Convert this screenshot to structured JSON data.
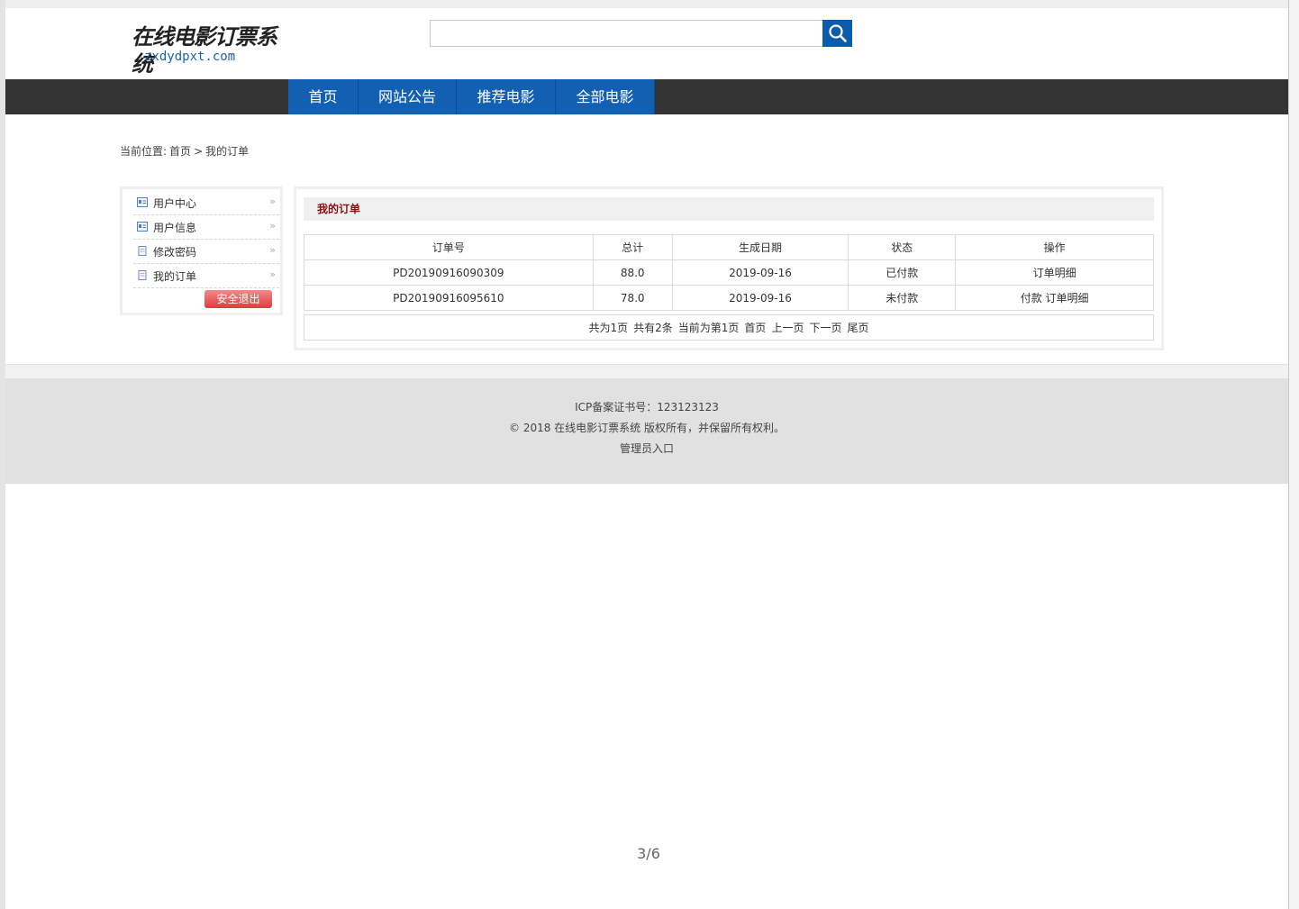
{
  "header": {
    "logo_title": "在线电影订票系统",
    "logo_domain": "zxdydpxt.com",
    "search": {
      "placeholder": "",
      "value": ""
    }
  },
  "nav": {
    "items": [
      {
        "label": "首页"
      },
      {
        "label": "网站公告"
      },
      {
        "label": "推荐电影"
      },
      {
        "label": "全部电影"
      }
    ],
    "colors": {
      "bar": "#333333",
      "item": "#1360b3"
    }
  },
  "breadcrumb": {
    "prefix": "当前位置:",
    "home": "首页",
    "sep": ">",
    "current": "我的订单"
  },
  "sidebar": {
    "items": [
      {
        "label": "用户中心",
        "icon": "user-card-icon"
      },
      {
        "label": "用户信息",
        "icon": "user-card-icon"
      },
      {
        "label": "修改密码",
        "icon": "document-icon"
      },
      {
        "label": "我的订单",
        "icon": "document-icon"
      }
    ],
    "logout_label": "安全退出"
  },
  "orders": {
    "title": "我的订单",
    "columns": [
      "订单号",
      "总计",
      "生成日期",
      "状态",
      "操作"
    ],
    "rows": [
      {
        "order_no": "PD20190916090309",
        "total": "88.0",
        "date": "2019-09-16",
        "status": "已付款",
        "actions": [
          "订单明细"
        ]
      },
      {
        "order_no": "PD20190916095610",
        "total": "78.0",
        "date": "2019-09-16",
        "status": "未付款",
        "actions": [
          "付款",
          "订单明细"
        ]
      }
    ]
  },
  "pagination": {
    "total_pages": "共为1页",
    "total_items": "共有2条",
    "current": "当前为第1页",
    "first": "首页",
    "prev": "上一页",
    "next": "下一页",
    "last": "尾页"
  },
  "footer": {
    "icp": "ICP备案证书号：123123123",
    "copyright": "© 2018 在线电影订票系统 版权所有，并保留所有权利。",
    "admin_link": "管理员入口"
  },
  "page_indicator": "3/6"
}
